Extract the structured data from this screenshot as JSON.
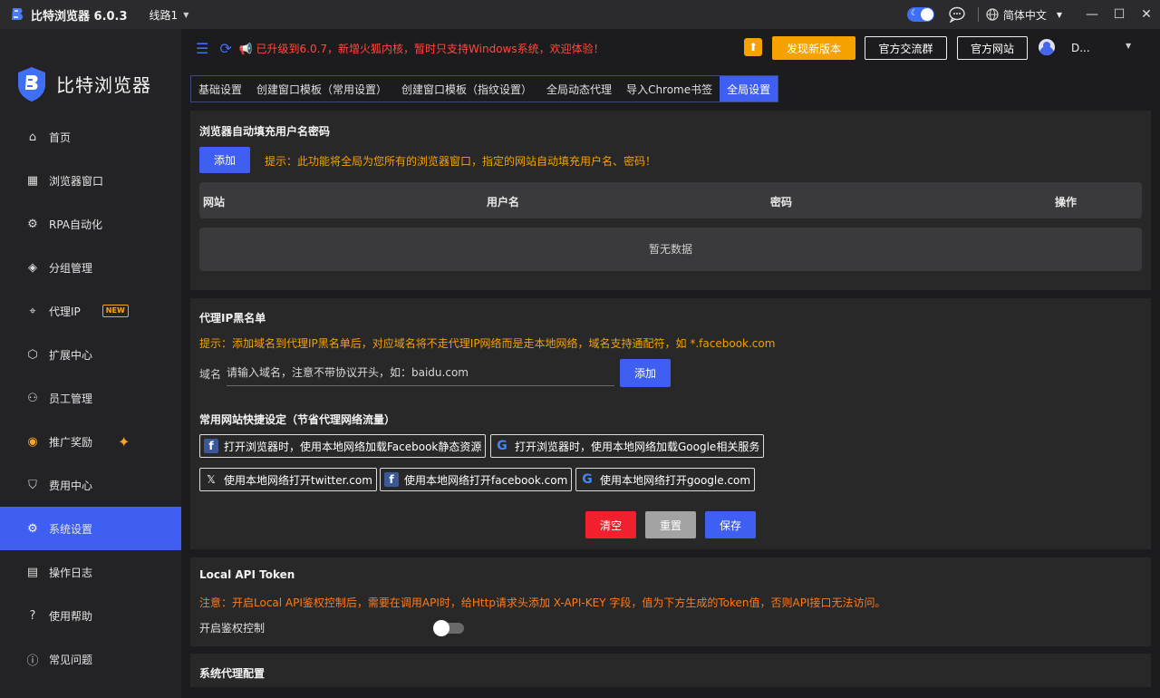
{
  "titlebar": {
    "app_title": "比特浏览器 6.0.3",
    "route": "线路1",
    "language": "简体中文"
  },
  "sidebar": {
    "brand": "比特浏览器",
    "items": [
      {
        "label": "首页",
        "icon": "home-icon"
      },
      {
        "label": "浏览器窗口",
        "icon": "grid-icon"
      },
      {
        "label": "RPA自动化",
        "icon": "robot-icon"
      },
      {
        "label": "分组管理",
        "icon": "layers-icon"
      },
      {
        "label": "代理IP",
        "icon": "location-pin-icon",
        "badge": "NEW"
      },
      {
        "label": "扩展中心",
        "icon": "cube-icon"
      },
      {
        "label": "员工管理",
        "icon": "staff-icon"
      },
      {
        "label": "推广奖励",
        "icon": "reward-icon"
      },
      {
        "label": "费用中心",
        "icon": "shield-yen-icon"
      },
      {
        "label": "系统设置",
        "icon": "gear-icon",
        "active": true
      },
      {
        "label": "操作日志",
        "icon": "log-icon"
      },
      {
        "label": "使用帮助",
        "icon": "help-icon"
      },
      {
        "label": "常见问题",
        "icon": "info-icon"
      }
    ]
  },
  "topbar": {
    "notice": "已升级到6.0.7，新增火狐内核，暂时只支持Windows系统，欢迎体验！",
    "new_version": "发现新版本",
    "group": "官方交流群",
    "website": "官方网站",
    "user": "D..."
  },
  "tabs": [
    "基础设置",
    "创建窗口模板（常用设置）",
    "创建窗口模板（指纹设置）",
    "全局动态代理",
    "导入Chrome书签",
    "全局设置"
  ],
  "autofill": {
    "title": "浏览器自动填充用户名密码",
    "add": "添加",
    "hint": "提示：此功能将全局为您所有的浏览器窗口，指定的网站自动填充用户名、密码！",
    "columns": [
      "网站",
      "用户名",
      "密码",
      "操作"
    ],
    "empty": "暂无数据"
  },
  "blacklist": {
    "title": "代理IP黑名单",
    "hint": "提示：添加域名到代理IP黑名单后，对应域名将不走代理IP网络而是走本地网络，域名支持通配符，如 *.facebook.com",
    "domain_label": "域名",
    "placeholder": "请输入域名，注意不带协议开头，如：baidu.com",
    "add": "添加",
    "quick_title": "常用网站快捷设定（节省代理网络流量）",
    "quick": [
      {
        "label": "打开浏览器时，使用本地网络加载Facebook静态资源",
        "icon": "facebook-icon"
      },
      {
        "label": "打开浏览器时，使用本地网络加载Google相关服务",
        "icon": "google-icon"
      },
      {
        "label": "使用本地网络打开twitter.com",
        "icon": "x-twitter-icon"
      },
      {
        "label": "使用本地网络打开facebook.com",
        "icon": "facebook-icon"
      },
      {
        "label": "使用本地网络打开google.com",
        "icon": "google-icon"
      }
    ],
    "clear": "清空",
    "reset": "重置",
    "save": "保存"
  },
  "api": {
    "title": "Local API Token",
    "note": "注意：开启Local API鉴权控制后，需要在调用API时，给Http请求头添加 X-API-KEY 字段，值为下方生成的Token值，否则API接口无法访问。",
    "toggle_label": "开启鉴权控制",
    "enabled": false
  },
  "sysproxy": {
    "title": "系统代理配置"
  }
}
